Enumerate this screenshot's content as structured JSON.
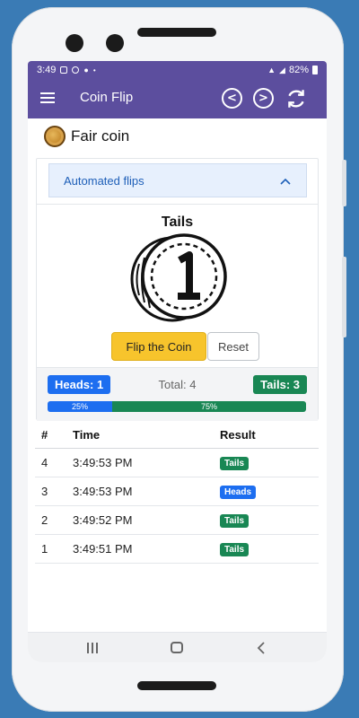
{
  "status_bar": {
    "time": "3:49",
    "battery": "82%"
  },
  "app_bar": {
    "title": "Coin Flip",
    "prev_symbol": "<",
    "next_symbol": ">"
  },
  "card": {
    "title": "Fair coin",
    "accordion_label": "Automated flips",
    "result": "Tails",
    "flip_button": "Flip the Coin",
    "reset_button": "Reset",
    "heads_badge": "Heads: 1",
    "tails_badge": "Tails: 3",
    "total": "Total: 4",
    "heads_percent": "25%",
    "tails_percent": "75%",
    "heads_fraction": 0.25,
    "tails_fraction": 0.75
  },
  "table": {
    "headers": [
      "#",
      "Time",
      "Result"
    ],
    "rows": [
      {
        "num": "4",
        "time": "3:49:53 PM",
        "result": "Tails"
      },
      {
        "num": "3",
        "time": "3:49:53 PM",
        "result": "Heads"
      },
      {
        "num": "2",
        "time": "3:49:52 PM",
        "result": "Tails"
      },
      {
        "num": "1",
        "time": "3:49:51 PM",
        "result": "Tails"
      }
    ]
  },
  "colors": {
    "app_bar": "#5c4e9e",
    "heads": "#1d6ef0",
    "tails": "#198754",
    "flip_button": "#f7c42c",
    "background": "#3a7bb5"
  }
}
